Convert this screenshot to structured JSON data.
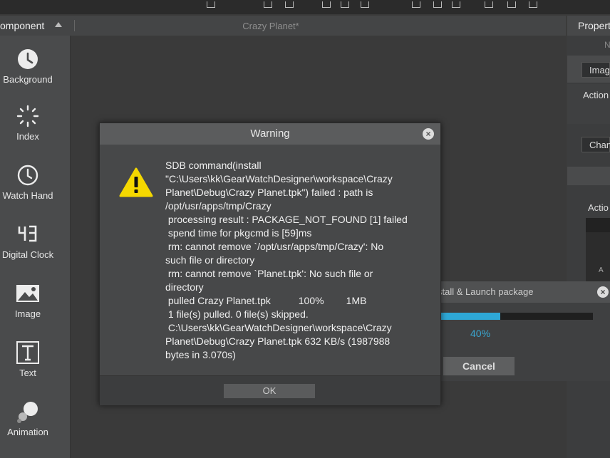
{
  "header": {
    "component_title": "omponent",
    "document_tab": "Crazy Planet*"
  },
  "sidebar": {
    "items": [
      {
        "label": "Background",
        "icon": "clock-filled-icon"
      },
      {
        "label": "Index",
        "icon": "dial-index-icon"
      },
      {
        "label": "Watch Hand",
        "icon": "watch-hand-icon"
      },
      {
        "label": "Digital Clock",
        "icon": "digital-clock-icon"
      },
      {
        "label": "Image",
        "icon": "image-icon"
      },
      {
        "label": "Text",
        "icon": "text-icon"
      },
      {
        "label": "Animation",
        "icon": "animation-icon"
      }
    ]
  },
  "properties": {
    "title": "Propert",
    "name_label": "N",
    "image_field": "Imag",
    "action_label": "Action",
    "change_field": "Chang",
    "action_label2": "Actio",
    "a_label": "A"
  },
  "progress_dialog": {
    "title": "stall & Launch package",
    "percent_value": 40,
    "percent_text": "40%",
    "cancel_label": "Cancel"
  },
  "warning_dialog": {
    "title": "Warning",
    "message": "SDB command(install\n\"C:\\Users\\kk\\GearWatchDesigner\\workspace\\Crazy\nPlanet\\Debug\\Crazy Planet.tpk\") failed : path is\n/opt/usr/apps/tmp/Crazy\n processing result : PACKAGE_NOT_FOUND [1] failed\n spend time for pkgcmd is [59]ms\n rm: cannot remove `/opt/usr/apps/tmp/Crazy': No\nsuch file or directory\n rm: cannot remove `Planet.tpk': No such file or\ndirectory\n pulled Crazy Planet.tpk          100%        1MB\n 1 file(s) pulled. 0 file(s) skipped.\n C:\\Users\\kk\\GearWatchDesigner\\workspace\\Crazy\nPlanet\\Debug\\Crazy Planet.tpk 632 KB/s (1987988\nbytes in 3.070s)",
    "ok_label": "OK"
  },
  "colors": {
    "accent": "#2ea8d7",
    "warning": "#f5d800"
  }
}
